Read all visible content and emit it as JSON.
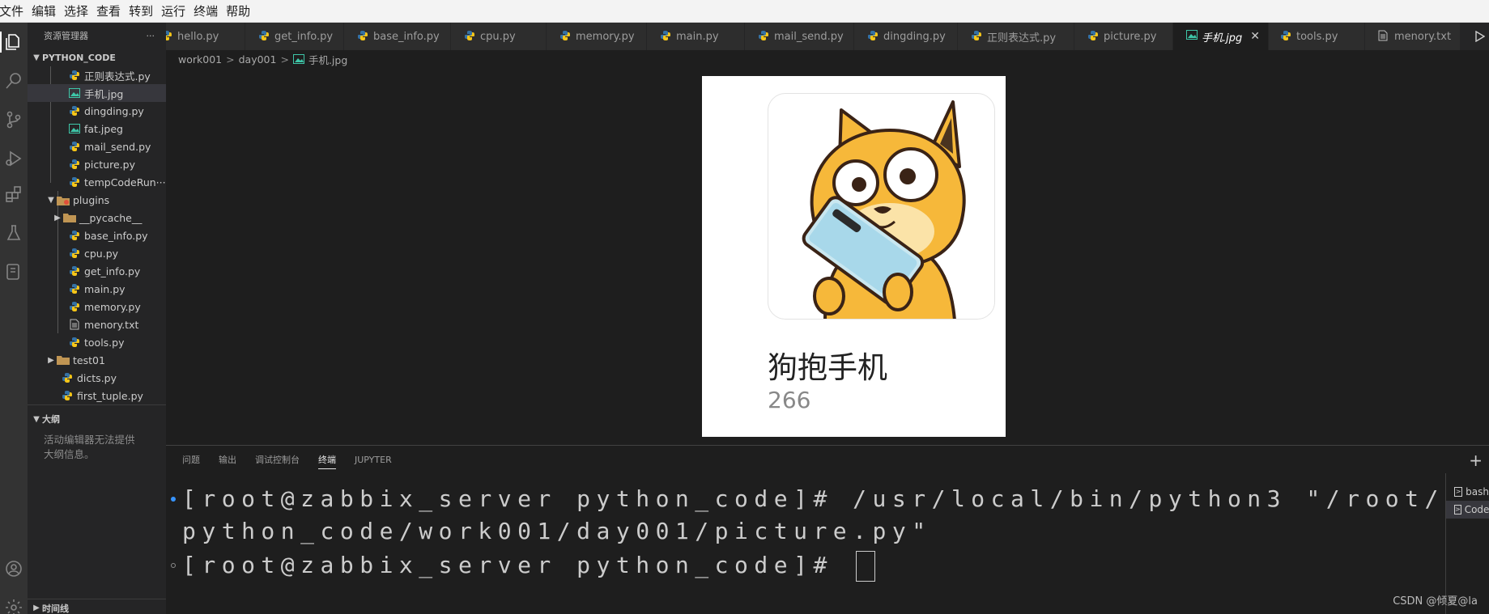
{
  "menu": [
    "文件",
    "编辑",
    "选择",
    "查看",
    "转到",
    "运行",
    "终端",
    "帮助"
  ],
  "sidebar": {
    "title": "资源管理器",
    "more": "···",
    "project": "PYTHON_CODE",
    "files": [
      {
        "label": "正则表达式.py",
        "type": "py"
      },
      {
        "label": "手机.jpg",
        "type": "img",
        "selected": true
      },
      {
        "label": "dingding.py",
        "type": "py"
      },
      {
        "label": "fat.jpeg",
        "type": "img"
      },
      {
        "label": "mail_send.py",
        "type": "py"
      },
      {
        "label": "picture.py",
        "type": "py"
      },
      {
        "label": "tempCodeRun···",
        "type": "py"
      }
    ],
    "plugins_folder": "plugins",
    "plugins": [
      {
        "label": "__pycache__",
        "type": "folder"
      },
      {
        "label": "base_info.py",
        "type": "py"
      },
      {
        "label": "cpu.py",
        "type": "py"
      },
      {
        "label": "get_info.py",
        "type": "py"
      },
      {
        "label": "main.py",
        "type": "py"
      },
      {
        "label": "memory.py",
        "type": "py"
      },
      {
        "label": "menory.txt",
        "type": "txt"
      },
      {
        "label": "tools.py",
        "type": "py"
      }
    ],
    "after": [
      {
        "label": "test01",
        "type": "folder"
      },
      {
        "label": "dicts.py",
        "type": "py"
      },
      {
        "label": "first_tuple.py",
        "type": "py"
      }
    ],
    "outline_title": "大纲",
    "outline_msg_1": "活动编辑器无法提供",
    "outline_msg_2": "大纲信息。",
    "timeline_title": "时间线"
  },
  "tabs": [
    {
      "label": "hello.py",
      "type": "py"
    },
    {
      "label": "get_info.py",
      "type": "py"
    },
    {
      "label": "base_info.py",
      "type": "py"
    },
    {
      "label": "cpu.py",
      "type": "py"
    },
    {
      "label": "memory.py",
      "type": "py"
    },
    {
      "label": "main.py",
      "type": "py"
    },
    {
      "label": "mail_send.py",
      "type": "py"
    },
    {
      "label": "dingding.py",
      "type": "py"
    },
    {
      "label": "正则表达式.py",
      "type": "py"
    },
    {
      "label": "picture.py",
      "type": "py"
    },
    {
      "label": "手机.jpg",
      "type": "img",
      "active": true
    },
    {
      "label": "tools.py",
      "type": "py"
    },
    {
      "label": "menory.txt",
      "type": "txt"
    }
  ],
  "breadcrumb": [
    "work001",
    "day001",
    "手机.jpg"
  ],
  "image": {
    "title": "狗抱手机",
    "count": "266"
  },
  "panel": {
    "tabs": [
      "问题",
      "输出",
      "调试控制台",
      "终端",
      "JUPYTER"
    ],
    "active_tab": "终端",
    "terminal_lines": [
      "[root@zabbix_server python_code]# /usr/local/bin/python3 \"/root/",
      "python_code/work001/day001/picture.py\"",
      "[root@zabbix_server python_code]# "
    ],
    "terminals": [
      "bash",
      "Code"
    ]
  },
  "watermark": "CSDN @倾夏@la",
  "colors": {
    "py_blue": "#3572A5",
    "py_yellow": "#f5c518",
    "img_icon": "#3ec6a8",
    "folder": "#c09553",
    "accent_dot": "#3794ff"
  }
}
